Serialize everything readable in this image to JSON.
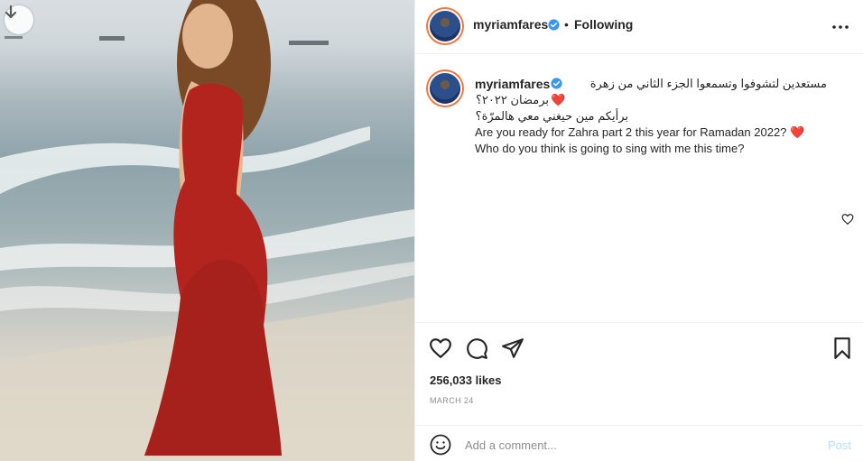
{
  "post": {
    "username": "myriamfares",
    "separator": "•",
    "follow_status": "Following",
    "caption": {
      "username": "myriamfares",
      "line1_ar": "مستعدين لتشوفوا وتسمعوا الجزء الثاني من زهرة",
      "line2_ar": "برمضان ٢٠٢٢؟",
      "line3_ar": "برأيكم مين حيغني معي هالمرّة؟",
      "line4_en": "Are you ready for Zahra part 2 this year for Ramadan 2022?",
      "line5_en": "Who do you think is going to sing with me this time?",
      "heart": "❤️"
    },
    "likes": "256,033 likes",
    "date": "MARCH 24"
  },
  "comment": {
    "placeholder": "Add a comment...",
    "post_label": "Post"
  },
  "icons": {
    "scroll": "arrow-down-icon",
    "verified": "verified-badge-icon",
    "more": "more-options-icon",
    "like": "heart-icon",
    "comment": "comment-icon",
    "share": "share-icon",
    "save": "bookmark-icon",
    "emoji": "emoji-icon"
  },
  "colors": {
    "dress": "#b3241f",
    "verified": "#3897f0",
    "post_disabled": "#b2dffc",
    "heart": "#ed4956"
  }
}
